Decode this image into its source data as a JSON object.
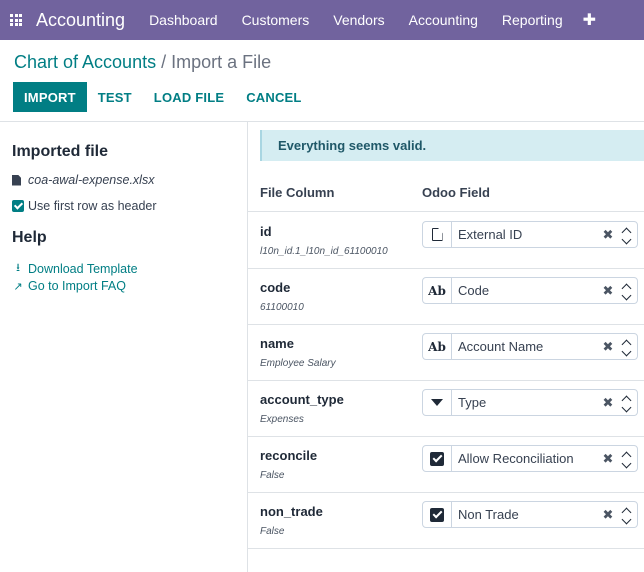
{
  "navbar": {
    "app_name": "Accounting",
    "menu": [
      "Dashboard",
      "Customers",
      "Vendors",
      "Accounting",
      "Reporting"
    ],
    "plus": "✚"
  },
  "breadcrumb": {
    "parent": "Chart of Accounts",
    "separator": "/",
    "current": "Import a File"
  },
  "actions": {
    "import": "IMPORT",
    "test": "TEST",
    "load_file": "LOAD FILE",
    "cancel": "CANCEL"
  },
  "sidebar": {
    "imported_title": "Imported file",
    "filename": "coa-awal-expense.xlsx",
    "header_option": "Use first row as header",
    "header_checked": true,
    "help_title": "Help",
    "download_template": "Download Template",
    "import_faq": "Go to Import FAQ"
  },
  "main": {
    "alert": "Everything seems valid.",
    "col_file": "File Column",
    "col_odoo": "Odoo Field",
    "rows": [
      {
        "column": "id",
        "sample": "l10n_id.1_l10n_id_61100010",
        "field": "External ID",
        "icon": "document-icon"
      },
      {
        "column": "code",
        "sample": "61100010",
        "field": "Code",
        "icon": "text-ab-icon"
      },
      {
        "column": "name",
        "sample": "Employee Salary",
        "field": "Account Name",
        "icon": "text-ab-icon"
      },
      {
        "column": "account_type",
        "sample": "Expenses",
        "field": "Type",
        "icon": "selection-triangle-icon"
      },
      {
        "column": "reconcile",
        "sample": "False",
        "field": "Allow Reconciliation",
        "icon": "checkbox-icon"
      },
      {
        "column": "non_trade",
        "sample": "False",
        "field": "Non Trade",
        "icon": "checkbox-icon"
      }
    ],
    "clear_glyph": "✖",
    "ab_glyph": "Ab"
  },
  "colors": {
    "navbar": "#71639e",
    "primary": "#017e84",
    "alert_bg": "#d5edf2"
  }
}
